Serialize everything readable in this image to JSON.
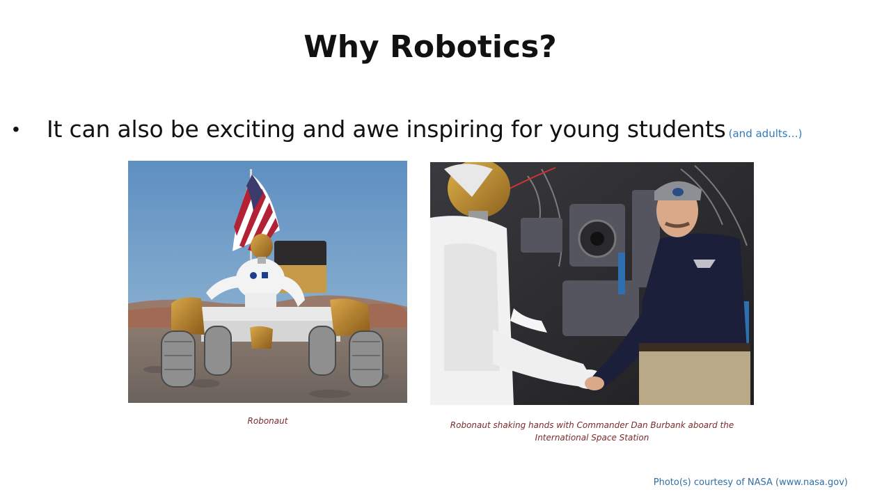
{
  "slide": {
    "title": "Why Robotics?",
    "bullet": {
      "text": "It can also be exciting and awe inspiring for young students",
      "aside": "(and adults…)"
    },
    "figures": [
      {
        "caption": "Robonaut"
      },
      {
        "caption_line1": "Robonaut shaking hands with Commander Dan Burbank aboard the",
        "caption_line2": "International Space Station"
      }
    ],
    "credit": "Photo(s) courtesy of NASA (www.nasa.gov)"
  },
  "colors": {
    "title_text": "#111111",
    "aside_text": "#2f7bbf",
    "caption_text": "#7a2a2a",
    "credit_text": "#2f6ea5",
    "background": "#ffffff"
  }
}
